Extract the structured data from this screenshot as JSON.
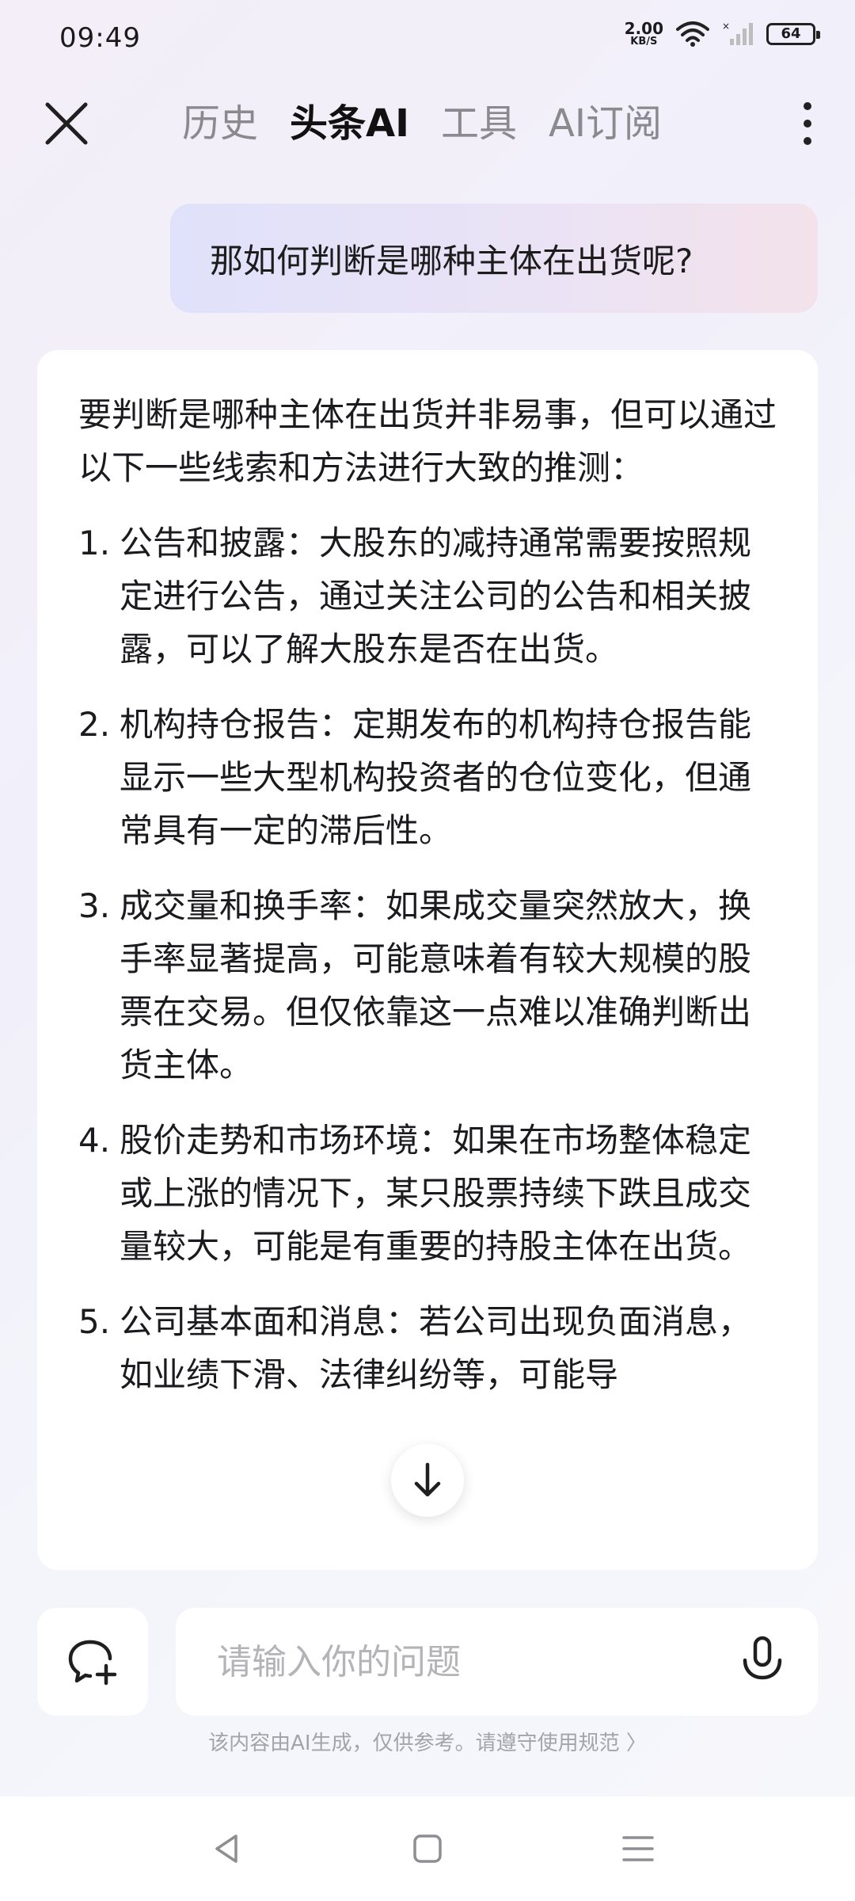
{
  "status_bar": {
    "time": "09:49",
    "net_speed_value": "2.00",
    "net_speed_unit": "KB/S",
    "battery": "64",
    "icons": [
      "wifi-icon",
      "signal-icon",
      "battery-icon"
    ]
  },
  "top_nav": {
    "close_icon": "close-icon",
    "tabs": [
      {
        "label": "历史",
        "active": false
      },
      {
        "label": "头条AI",
        "active": true
      },
      {
        "label": "工具",
        "active": false
      },
      {
        "label": "AI订阅",
        "active": false
      }
    ],
    "more_icon": "more-vertical-icon"
  },
  "conversation": {
    "user_message": "那如何判断是哪种主体在出货呢?",
    "answer": {
      "intro": "要判断是哪种主体在出货并非易事，但可以通过以下一些线索和方法进行大致的推测：",
      "points": [
        {
          "num": "1.",
          "text": "公告和披露：大股东的减持通常需要按照规定进行公告，通过关注公司的公告和相关披露，可以了解大股东是否在出货。"
        },
        {
          "num": "2.",
          "text": "机构持仓报告：定期发布的机构持仓报告能显示一些大型机构投资者的仓位变化，但通常具有一定的滞后性。"
        },
        {
          "num": "3.",
          "text": "成交量和换手率：如果成交量突然放大，换手率显著提高，可能意味着有较大规模的股票在交易。但仅依靠这一点难以准确判断出货主体。"
        },
        {
          "num": "4.",
          "text": "股价走势和市场环境：如果在市场整体稳定或上涨的情况下，某只股票持续下跌且成交量较大，可能是有重要的持股主体在出货。"
        },
        {
          "num": "5.",
          "text": "公司基本面和消息：若公司出现负面消息，如业绩下滑、法律纠纷等，可能导"
        }
      ]
    },
    "scroll_down_icon": "arrow-down-icon"
  },
  "input_bar": {
    "new_chat_icon": "new-chat-icon",
    "placeholder": "请输入你的问题",
    "value": "",
    "mic_icon": "mic-icon"
  },
  "disclaimer": "该内容由AI生成，仅供参考。请遵守使用规范 〉",
  "system_nav": {
    "icons": [
      "back-triangle-icon",
      "home-square-icon",
      "recents-menu-icon"
    ]
  }
}
